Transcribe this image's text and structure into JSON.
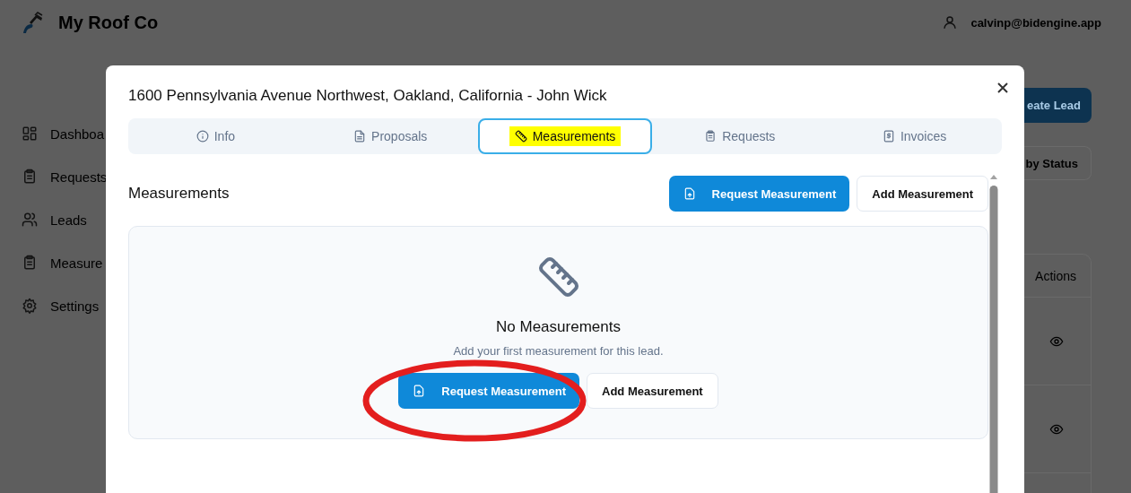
{
  "app": {
    "name": "My Roof Co",
    "user_email": "calvinp@bidengine.app"
  },
  "sidebar": {
    "items": [
      {
        "label": "Dashboa"
      },
      {
        "label": "Requests"
      },
      {
        "label": "Leads"
      },
      {
        "label": "Measure"
      },
      {
        "label": "Settings"
      }
    ]
  },
  "background": {
    "create_button": "eate Lead",
    "filter_button": "by Status",
    "table": {
      "columns": [
        "Actions"
      ]
    }
  },
  "modal": {
    "title": "1600 Pennsylvania Avenue Northwest, Oakland, California - John Wick",
    "tabs": [
      {
        "label": "Info",
        "selected": false
      },
      {
        "label": "Proposals",
        "selected": false
      },
      {
        "label": "Measurements",
        "selected": true
      },
      {
        "label": "Requests",
        "selected": false
      },
      {
        "label": "Invoices",
        "selected": false
      }
    ],
    "section": {
      "heading": "Measurements",
      "buttons": [
        {
          "label": "Request Measurement",
          "kind": "primary"
        },
        {
          "label": "Add Measurement",
          "kind": "secondary"
        }
      ]
    },
    "empty_state": {
      "title": "No Measurements",
      "message": "Add your first measurement for this lead.",
      "buttons": [
        {
          "label": "Request Measurement",
          "kind": "primary"
        },
        {
          "label": "Add Measurement",
          "kind": "secondary"
        }
      ]
    }
  }
}
